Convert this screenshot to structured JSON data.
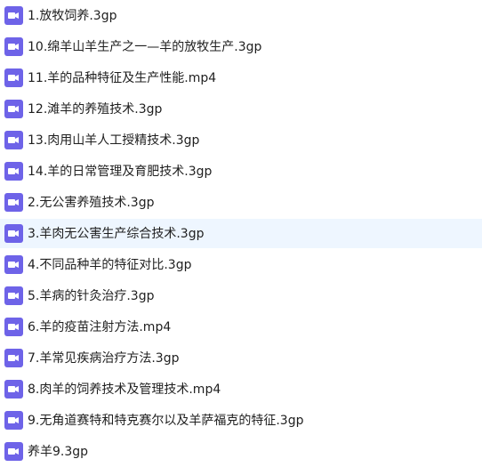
{
  "file_list": {
    "icon": "video-file-icon",
    "icon_color": "#6e63e8",
    "selected_index": 7,
    "selected_bg": "#eef6ff",
    "items": [
      "1.放牧饲养.3gp",
      "10.绵羊山羊生产之一—羊的放牧生产.3gp",
      "11.羊的品种特征及生产性能.mp4",
      "12.滩羊的养殖技术.3gp",
      "13.肉用山羊人工授精技术.3gp",
      "14.羊的日常管理及育肥技术.3gp",
      "2.无公害养殖技术.3gp",
      "3.羊肉无公害生产综合技术.3gp",
      "4.不同品种羊的特征对比.3gp",
      "5.羊病的针灸治疗.3gp",
      "6.羊的疫苗注射方法.mp4",
      "7.羊常见疾病治疗方法.3gp",
      "8.肉羊的饲养技术及管理技术.mp4",
      "9.无角道赛特和特克赛尔以及羊萨福克的特征.3gp",
      "养羊9.3gp"
    ]
  }
}
